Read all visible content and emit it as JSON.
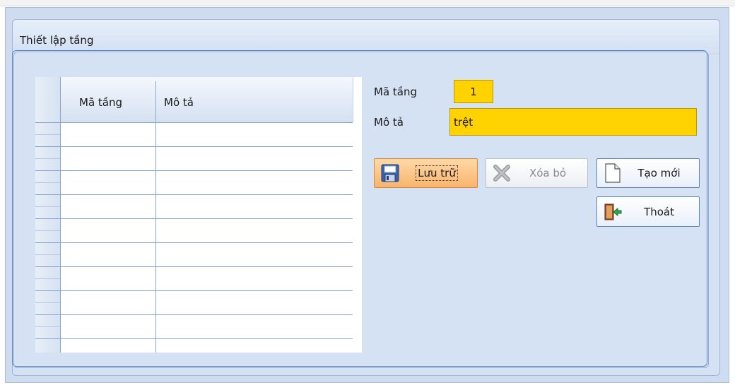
{
  "group": {
    "title": "Thiết lập tầng"
  },
  "grid": {
    "columns": [
      "Mã tầng",
      "Mô tả"
    ],
    "rows": []
  },
  "form": {
    "ma_tang_label": "Mã tầng",
    "ma_tang_value": "1",
    "mo_ta_label": "Mô tả",
    "mo_ta_value": "trệt"
  },
  "buttons": {
    "save": "Lưu trữ",
    "delete": "Xóa bỏ",
    "new": "Tạo mới",
    "exit": "Thoát"
  },
  "colors": {
    "field_bg": "#ffd200",
    "save_button": "#f9b46c",
    "panel": "#cfdcef"
  },
  "icons": {
    "save": "floppy-disk-icon",
    "delete": "x-icon",
    "new": "blank-document-icon",
    "exit": "exit-door-icon"
  }
}
